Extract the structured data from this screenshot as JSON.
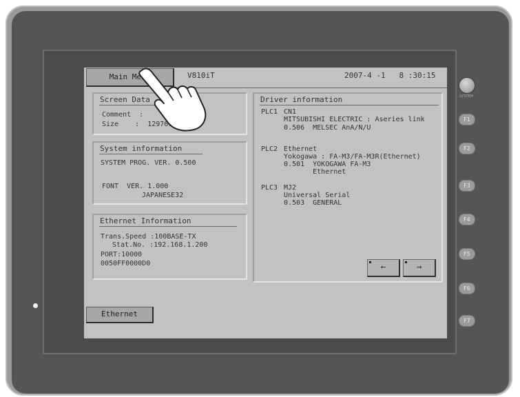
{
  "header": {
    "main_menu_label": "Main Menu",
    "model": "V810iT",
    "datetime": "2007-4 -1   8 :30:15"
  },
  "screen_data": {
    "title": "Screen Data",
    "comment_line": "Comment  :",
    "size_line": "Size    :  12976128"
  },
  "system_info": {
    "title": "System information",
    "prog_version": "SYSTEM PROG. VER. 0.500",
    "font_version": "FONT  VER. 1.000",
    "font_name": "JAPANESE32"
  },
  "ethernet_info": {
    "title": "Ethernet Information",
    "trans_speed": "Trans.Speed :100BASE-TX",
    "station": "Stat.No. :192.168.1.200",
    "port": "PORT:10000",
    "mac": "0050FF0000D0"
  },
  "driver_info": {
    "title": "Driver information",
    "plcs": [
      {
        "id": "PLC1",
        "port": "CN1",
        "lines": [
          "MITSUBISHI ELECTRIC : Aseries link",
          "0.506  MELSEC AnA/N/U"
        ]
      },
      {
        "id": "PLC2",
        "port": "Ethernet",
        "lines": [
          "Yokogawa : FA-M3/FA-M3R(Ethernet)",
          "0.501  YOKOGAWA FA-M3",
          "       Ethernet"
        ]
      },
      {
        "id": "PLC3",
        "port": "MJ2",
        "lines": [
          "Universal Serial",
          "0.503  GENERAL"
        ]
      }
    ],
    "prev_arrow": "←",
    "next_arrow": "→"
  },
  "footer": {
    "ethernet_button": "Ethernet"
  },
  "hardware": {
    "function_keys": [
      "F1",
      "F2",
      "F3",
      "F4",
      "F5",
      "F6",
      "F7"
    ],
    "power_label": "SYSTEM"
  }
}
